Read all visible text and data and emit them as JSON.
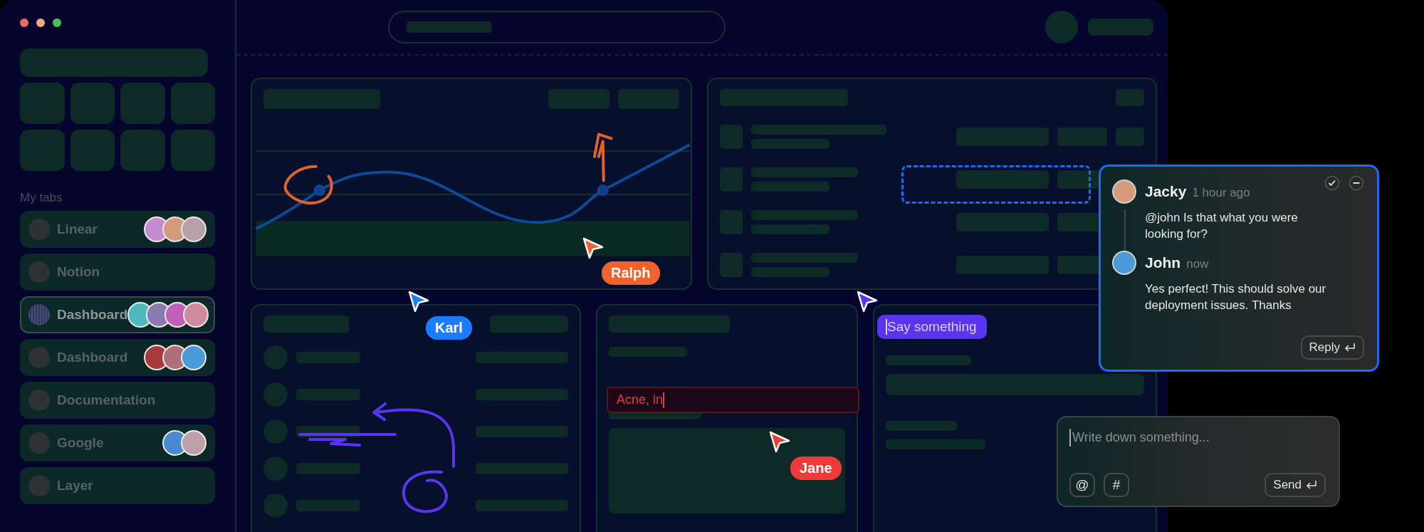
{
  "sidebar": {
    "section_title": "My tabs",
    "tabs": [
      {
        "label": "Linear",
        "selected": false,
        "avatars": [
          {
            "color": "#c58ad0"
          },
          {
            "color": "#d49a7a"
          },
          {
            "color": "#b8a0a8"
          }
        ]
      },
      {
        "label": "Notion",
        "selected": false
      },
      {
        "label": "Dashboard",
        "selected": true,
        "avatars": [
          {
            "color": "#4fb8c0"
          },
          {
            "color": "#8a7ab0"
          },
          {
            "color": "#c060b8"
          },
          {
            "color": "#d08a9a"
          }
        ]
      },
      {
        "label": "Dashboard",
        "selected": false,
        "avatars": [
          {
            "color": "#a83a3a"
          },
          {
            "color": "#b0707a"
          },
          {
            "color": "#4a9ad8"
          }
        ]
      },
      {
        "label": "Documentation",
        "selected": false
      },
      {
        "label": "Google",
        "selected": false,
        "avatars": [
          {
            "color": "#4a8ad0"
          },
          {
            "color": "#c0a0a8"
          }
        ]
      },
      {
        "label": "Layer",
        "selected": false
      }
    ]
  },
  "cursors": [
    {
      "name": "Karl",
      "color": "#1a7cff"
    },
    {
      "name": "Ralph",
      "color": "#f0622d"
    },
    {
      "name": "Jane",
      "color": "#f03a3a"
    }
  ],
  "chat_cursor": {
    "message": "Say something",
    "color": "#5b34f0"
  },
  "text_field": {
    "value": "Acne, in"
  },
  "comment_thread": {
    "comments": [
      {
        "author": "Jacky",
        "time": "1 hour ago",
        "text": "@john Is that what you were looking for?",
        "color": "#d49a7a"
      },
      {
        "author": "John",
        "time": "now",
        "text": "Yes perfect! This should solve our deployment issues. Thanks",
        "color": "#4a9ad8"
      }
    ],
    "reply_button": "Reply"
  },
  "composer": {
    "placeholder": "Write down something...",
    "tools": [
      "@",
      "#"
    ],
    "send_button": "Send"
  }
}
